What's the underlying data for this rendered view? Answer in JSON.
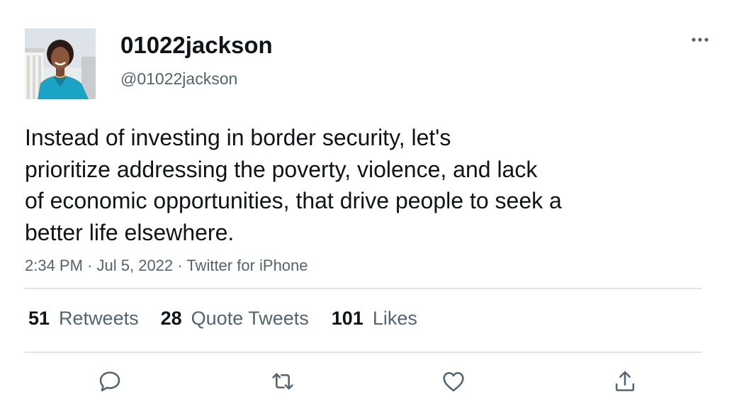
{
  "user": {
    "display_name": "01022jackson",
    "handle": "@01022jackson"
  },
  "tweet": {
    "text_lines": [
      "Instead of investing in border security, let's",
      "prioritize addressing the poverty, violence, and lack",
      "of economic opportunities, that drive people to seek a",
      "better life elsewhere."
    ],
    "time": "2:34 PM",
    "separator": "·",
    "date": "Jul 5, 2022",
    "source": "Twitter for iPhone"
  },
  "stats": {
    "retweets": {
      "count": "51",
      "label": "Retweets"
    },
    "quote_tweets": {
      "count": "28",
      "label": "Quote Tweets"
    },
    "likes": {
      "count": "101",
      "label": "Likes"
    }
  },
  "icons": {
    "more": "more-horizontal-icon",
    "reply": "reply-icon",
    "retweet": "retweet-icon",
    "like": "heart-icon",
    "share": "share-icon"
  },
  "colors": {
    "text_primary": "#0f1419",
    "text_secondary": "#536471",
    "divider": "#dfe3e6"
  }
}
